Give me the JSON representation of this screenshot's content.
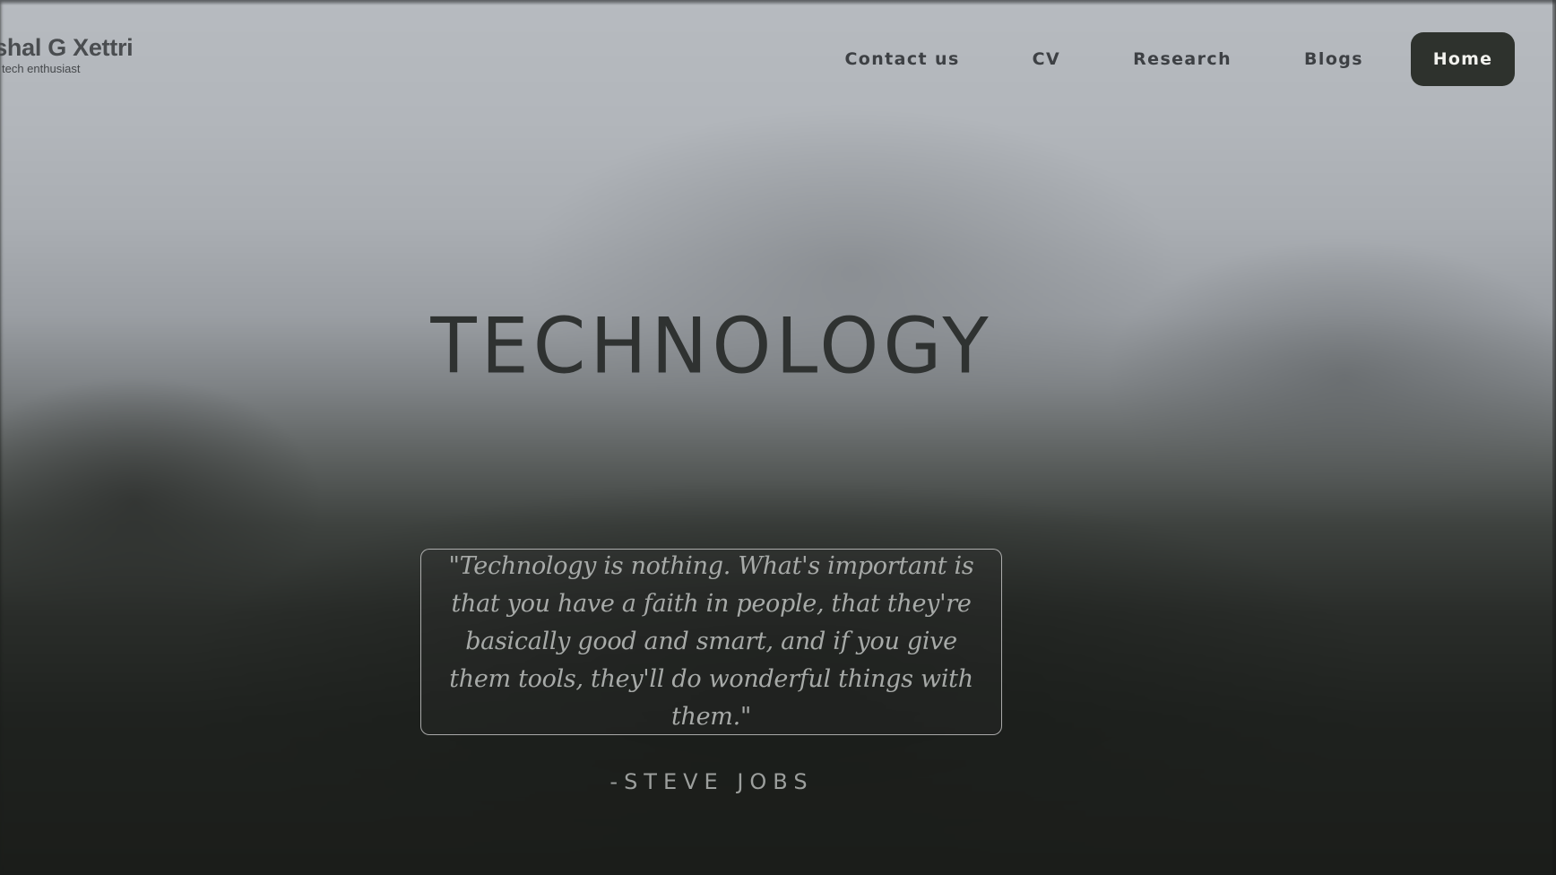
{
  "brand": {
    "name": "ishal G Xettri",
    "tagline": "tech enthusiast"
  },
  "nav": {
    "items": [
      {
        "label": "Contact us"
      },
      {
        "label": "CV"
      },
      {
        "label": "Research"
      },
      {
        "label": "Blogs"
      },
      {
        "label": "Home",
        "active": true
      }
    ]
  },
  "hero": {
    "title": "TECHNOLOGY"
  },
  "quote": {
    "text": "\"Technology is nothing. What's important is that you have a faith in people, that they're basically good and smart, and if you give them tools, they'll do wonderful things with them.\"",
    "author": "-STEVE JOBS"
  },
  "colors": {
    "active_nav_bg": "#2e322d",
    "active_nav_text": "#f2f2ee",
    "nav_text": "#3d4044",
    "title_text": "#2f3231",
    "quote_text": "#a7aaa8"
  }
}
